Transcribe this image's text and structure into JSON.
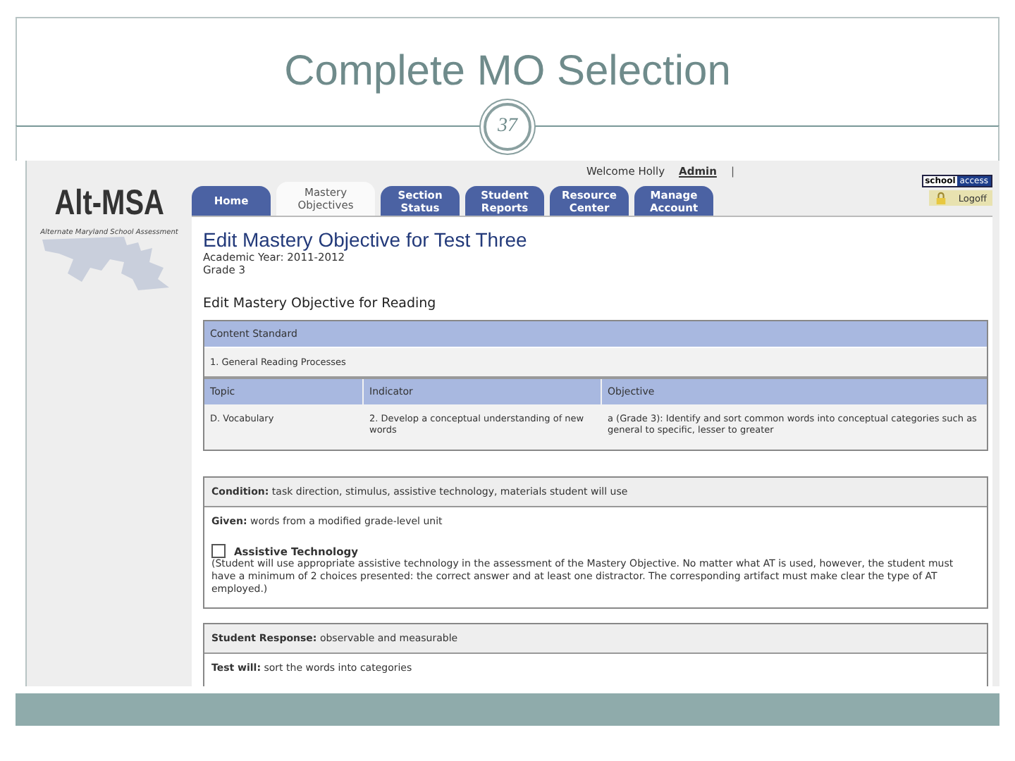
{
  "slide": {
    "title": "Complete MO Selection",
    "page_number": "37"
  },
  "app": {
    "logo": {
      "name": "Alt-MSA",
      "tagline": "Alternate Maryland School Assessment"
    },
    "welcome": "Welcome Holly",
    "admin_link": "Admin",
    "separator": "|",
    "brand": {
      "left": "school",
      "right": "access"
    },
    "logoff": "Logoff",
    "tabs": [
      {
        "label": "Home",
        "selected": false
      },
      {
        "label": "Mastery Objectives",
        "selected": true
      },
      {
        "label": "Section Status",
        "selected": false
      },
      {
        "label": "Student Reports",
        "selected": false
      },
      {
        "label": "Resource Center",
        "selected": false
      },
      {
        "label": "Manage Account",
        "selected": false
      }
    ],
    "page_title": "Edit Mastery Objective for Test Three",
    "academic_year": "Academic Year: 2011-2012",
    "grade": "Grade 3",
    "section_title": "Edit Mastery Objective for Reading",
    "content_standard": {
      "heading": "Content Standard",
      "value": "1. General Reading Processes"
    },
    "table": {
      "columns": [
        "Topic",
        "Indicator",
        "Objective"
      ],
      "rows": [
        [
          "D. Vocabulary",
          "2. Develop a conceptual understanding of new words",
          "a (Grade 3): Identify and sort common words into conceptual categories such as general to specific, lesser to greater"
        ]
      ]
    },
    "condition": "**Condition:** task direction, stimulus, assistive technology, materials student will use",
    "given": "**Given:** words from a modified grade-level unit",
    "assistive": {
      "label": "Assistive Technology",
      "checked": false,
      "note": "(Student will use appropriate assistive technology in the assessment of the Mastery Objective. No matter what AT is used, however, the student must have a minimum of 2 choices presented: the correct answer and at least one distractor. The corresponding artifact must make clear the type of AT employed.)"
    },
    "response": "**Student Response:** observable and measurable",
    "test_will": "**Test will:** sort the words into categories"
  }
}
